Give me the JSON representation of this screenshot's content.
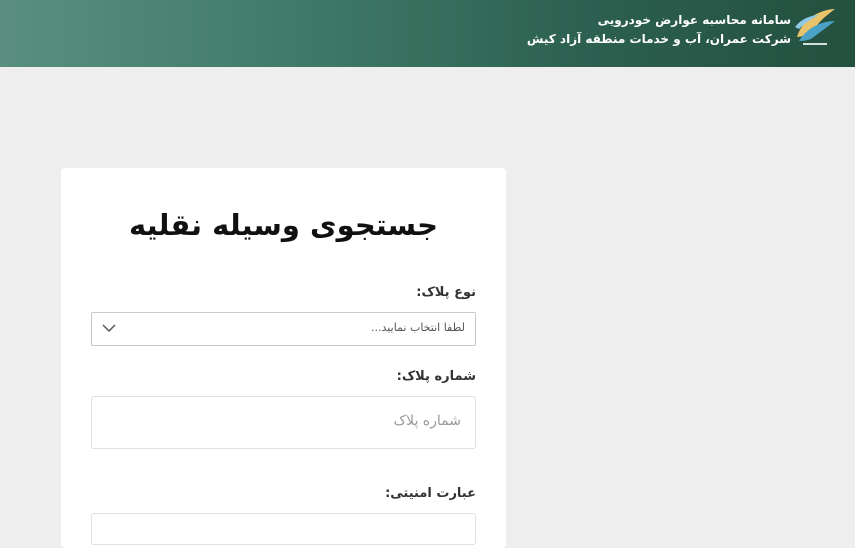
{
  "header": {
    "title": "سامانه محاسبه عوارض خودرویی",
    "subtitle": "شرکت عمران، آب و خدمات منطقه آزاد کیش",
    "logo_icon": "kish-company-logo-icon",
    "colors": {
      "header_start": "#5a8f80",
      "header_end": "#24503f"
    }
  },
  "form": {
    "title": "جستجوی وسیله نقلیه",
    "plate_type": {
      "label": "نوع پلاک:",
      "selected": "لطفا انتخاب نمایید..."
    },
    "plate_number": {
      "label": "شماره پلاک:",
      "placeholder": "شماره پلاک"
    },
    "captcha": {
      "label": "عبارت امنیتی:"
    }
  }
}
